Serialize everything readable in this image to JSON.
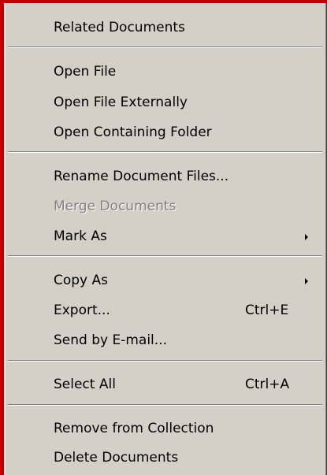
{
  "menu": {
    "related_documents": "Related Documents",
    "open_file": "Open File",
    "open_file_externally": "Open File Externally",
    "open_containing_folder": "Open Containing Folder",
    "rename_document_files": "Rename Document Files...",
    "merge_documents": "Merge Documents",
    "mark_as": "Mark As",
    "copy_as": "Copy As",
    "export": "Export...",
    "export_shortcut": "Ctrl+E",
    "send_by_email": "Send by E-mail...",
    "select_all": "Select All",
    "select_all_shortcut": "Ctrl+A",
    "remove_from_collection": "Remove from Collection",
    "delete_documents": "Delete Documents"
  },
  "colors": {
    "menu_background": "#d4d0c8",
    "frame_accent": "#c00000",
    "disabled_text": "#808080"
  },
  "icons": {
    "submenu_arrow": "chevron-right-icon"
  }
}
